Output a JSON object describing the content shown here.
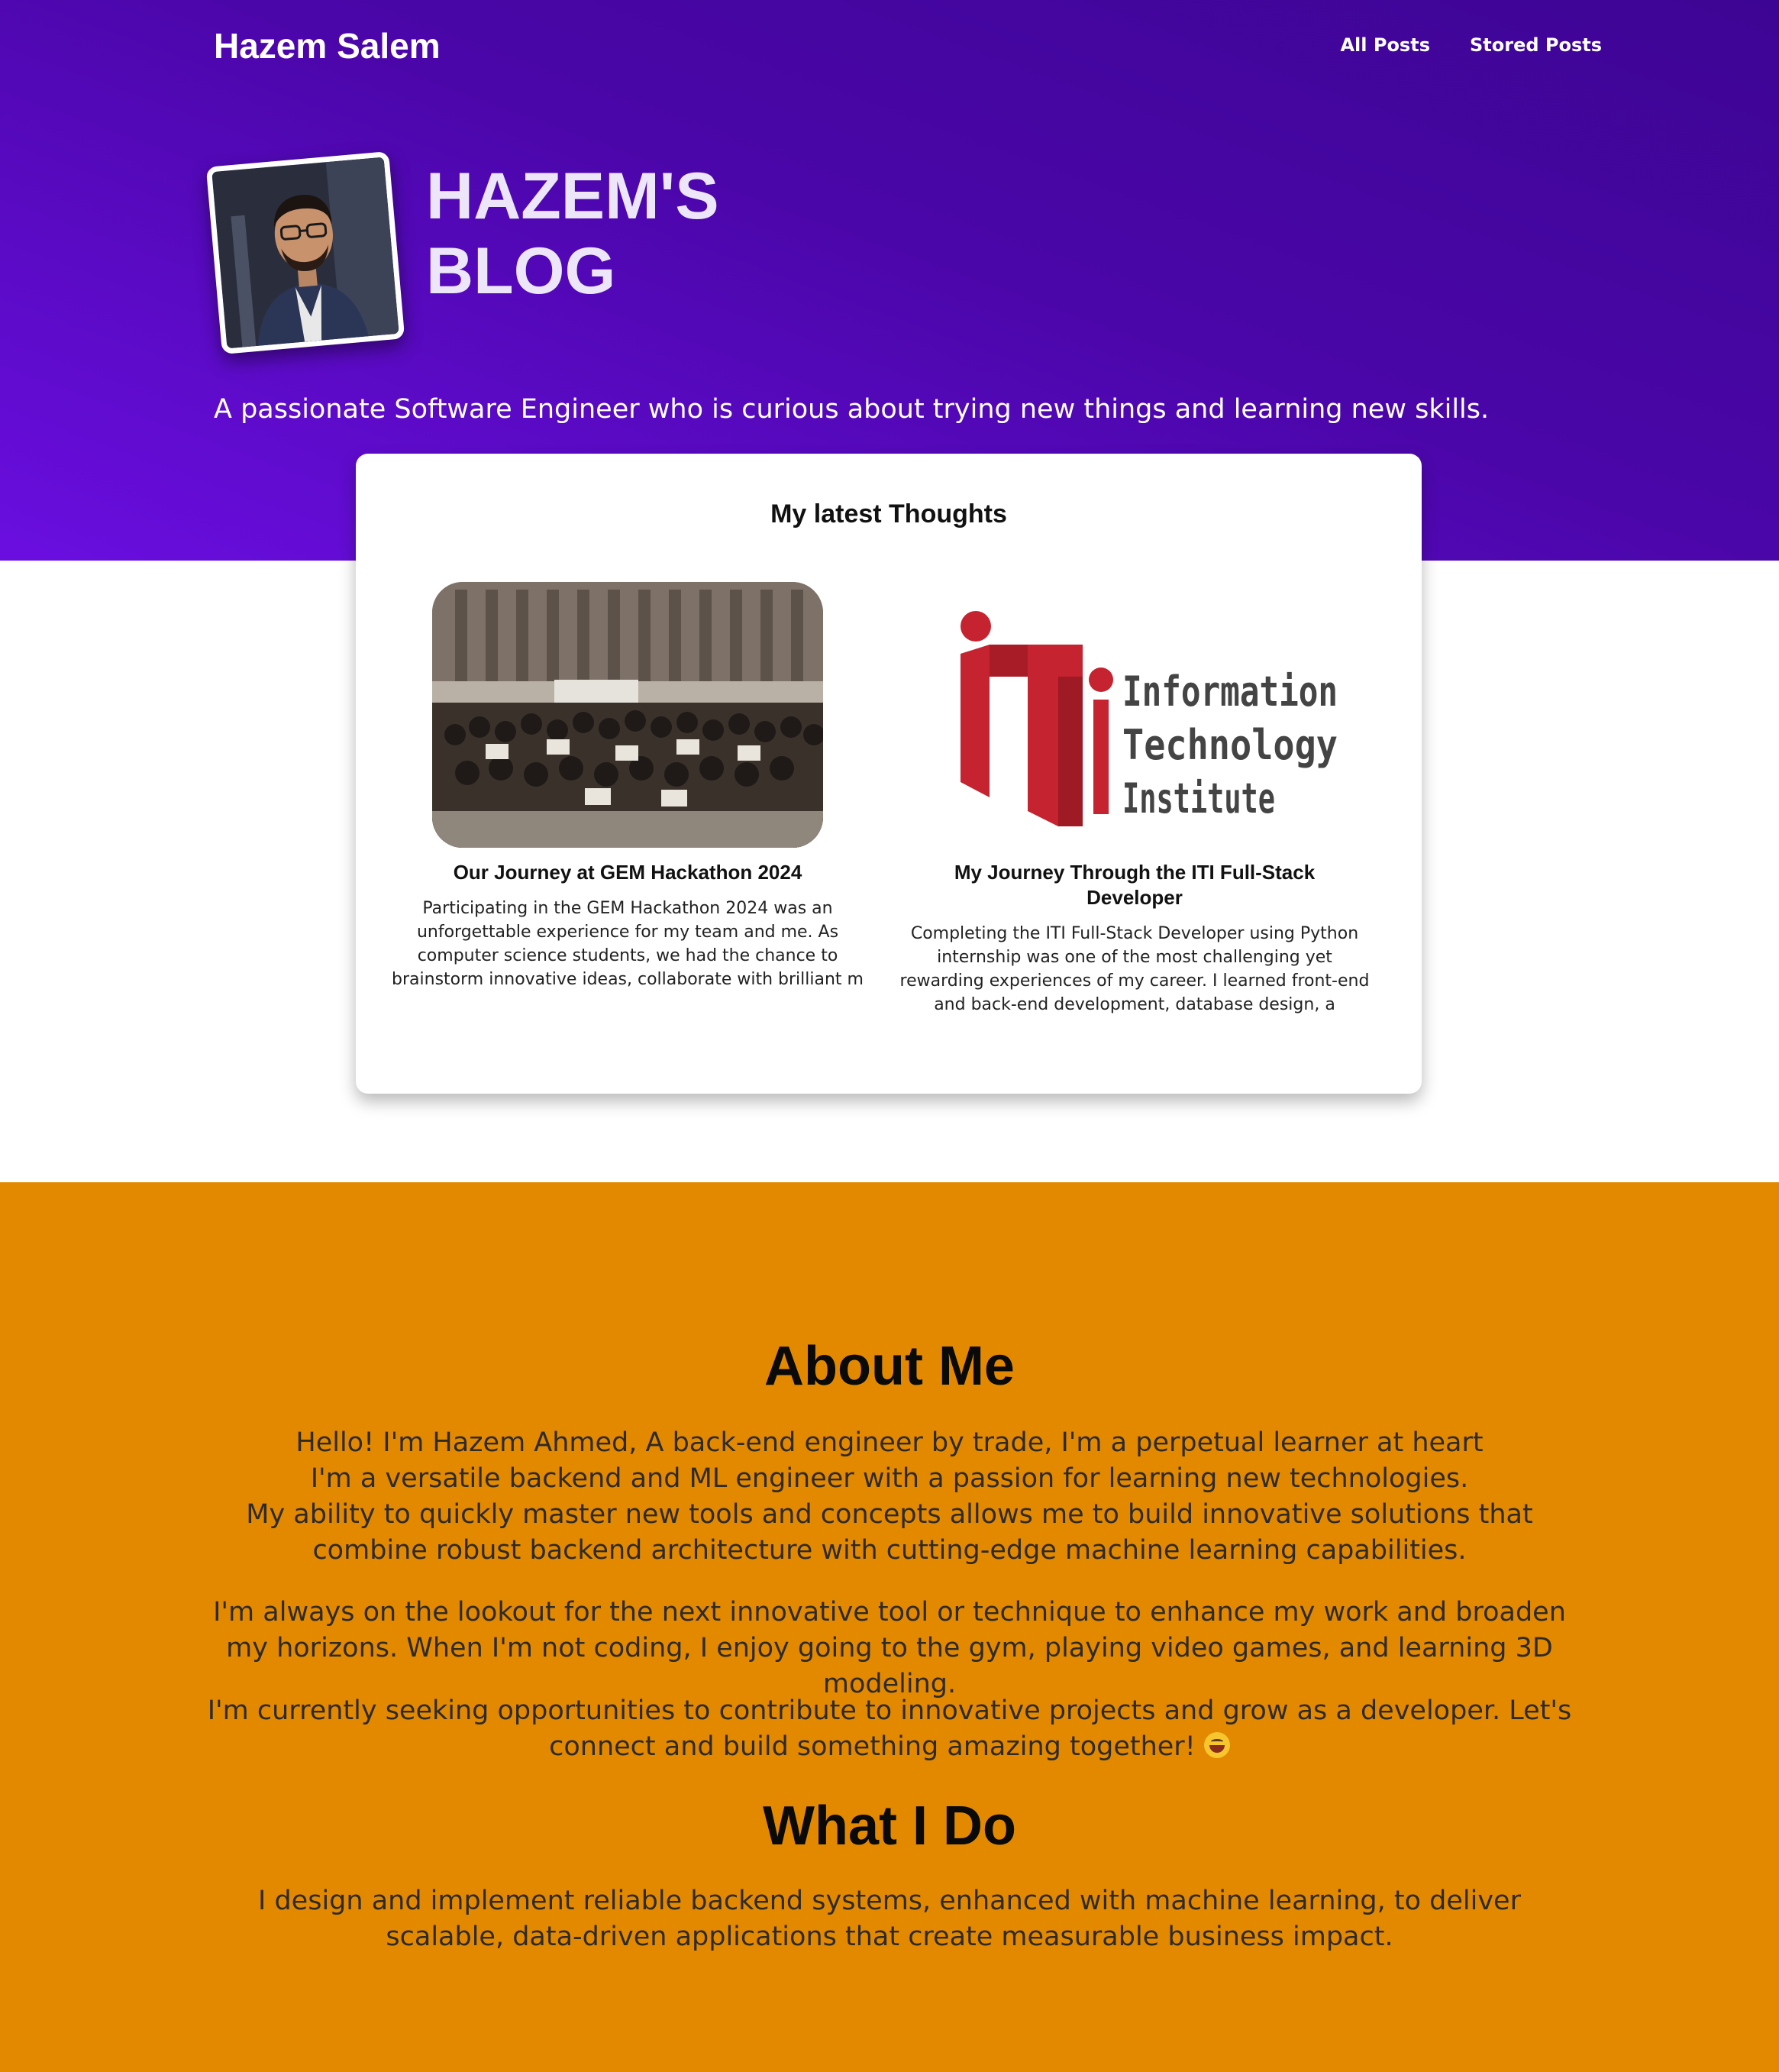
{
  "header": {
    "brand": "Hazem Salem",
    "nav": [
      "All Posts",
      "Stored Posts"
    ]
  },
  "hero": {
    "title_line1": "HAZEM'S",
    "title_line2": "BLOG",
    "tagline": "A passionate Software Engineer who is curious about trying new things and learning new skills."
  },
  "latest": {
    "title": "My latest Thoughts",
    "posts": [
      {
        "title": "Our Journey at GEM Hackathon 2024",
        "excerpt": "Participating in the GEM Hackathon 2024 was an unforgettable experience for my team and me. As computer science students, we had the chance to brainstorm innovative ideas, collaborate with brilliant m",
        "image": "group-photo"
      },
      {
        "title": "My Journey Through the ITI Full-Stack Developer",
        "excerpt": "Completing the ITI Full-Stack Developer using Python internship was one of the most challenging yet rewarding experiences of my career. I learned front-end and back-end development, database design, a",
        "image": "iti-logo",
        "logo_text": [
          "Information",
          "Technology",
          "Institute"
        ]
      }
    ]
  },
  "about": {
    "title": "About Me",
    "p1": "Hello! I'm Hazem Ahmed, A back-end engineer by trade, I'm a perpetual learner at heart I'm a versatile backend and ML engineer with a passion for learning new technologies. My ability to quickly master new tools and concepts allows me to build innovative solutions that combine robust backend architecture with cutting-edge machine learning capabilities.",
    "p1_lines": [
      "Hello! I'm Hazem Ahmed, A back-end engineer by trade, I'm a perpetual learner at heart",
      "I'm a versatile backend and ML engineer with a passion for learning new technologies.",
      "My ability to quickly master new tools and concepts allows me to build innovative solutions that combine robust backend architecture with cutting-edge machine learning capabilities."
    ],
    "p2": "I'm always on the lookout for the next innovative tool or technique to enhance my work and broaden my horizons. When I'm not coding, I enjoy going to the gym, playing video games, and learning 3D modeling.",
    "p3": "I'm currently seeking opportunities to contribute to innovative projects and grow as a developer. Let's connect and build something amazing together!"
  },
  "whatido": {
    "title": "What I Do",
    "text": "I design and implement reliable backend systems, enhanced with machine learning, to deliver scalable, data-driven applications that create measurable business impact."
  },
  "colors": {
    "hero_gradient_start": "#3d0594",
    "hero_gradient_end": "#6a0ee0",
    "about_bg": "#e38900",
    "iti_red": "#c4232f"
  },
  "icons": [
    "smiling-face-with-tongue-emoji"
  ]
}
